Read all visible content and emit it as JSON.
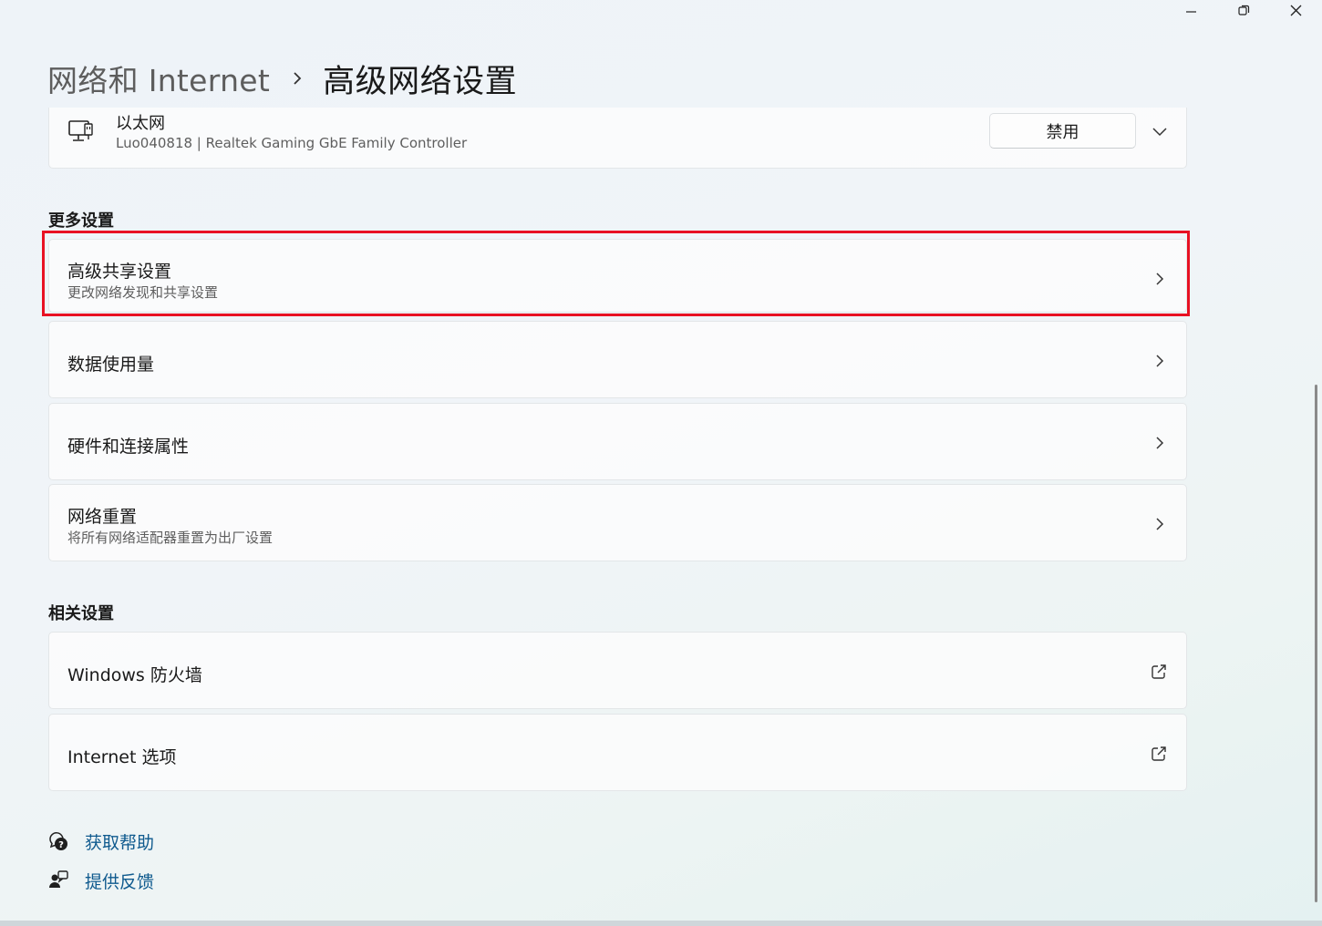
{
  "window": {
    "controls": [
      "minimize-icon",
      "maximize-icon",
      "close-icon"
    ]
  },
  "header": {
    "breadcrumb_parent": "网络和 Internet",
    "breadcrumb_current": "高级网络设置"
  },
  "adapter": {
    "name": "以太网",
    "description": "Luo040818 | Realtek Gaming GbE Family Controller",
    "disable_label": "禁用"
  },
  "more_settings": {
    "heading": "更多设置",
    "items": [
      {
        "title": "高级共享设置",
        "subtitle": "更改网络发现和共享设置",
        "highlighted": true
      },
      {
        "title": "数据使用量",
        "subtitle": ""
      },
      {
        "title": "硬件和连接属性",
        "subtitle": ""
      },
      {
        "title": "网络重置",
        "subtitle": "将所有网络适配器重置为出厂设置"
      }
    ]
  },
  "related_settings": {
    "heading": "相关设置",
    "items": [
      {
        "title": "Windows 防火墙"
      },
      {
        "title": "Internet 选项"
      }
    ]
  },
  "footer": {
    "help": "获取帮助",
    "feedback": "提供反馈"
  },
  "colors": {
    "highlight": "#e81123",
    "link": "#0f5a8e"
  }
}
